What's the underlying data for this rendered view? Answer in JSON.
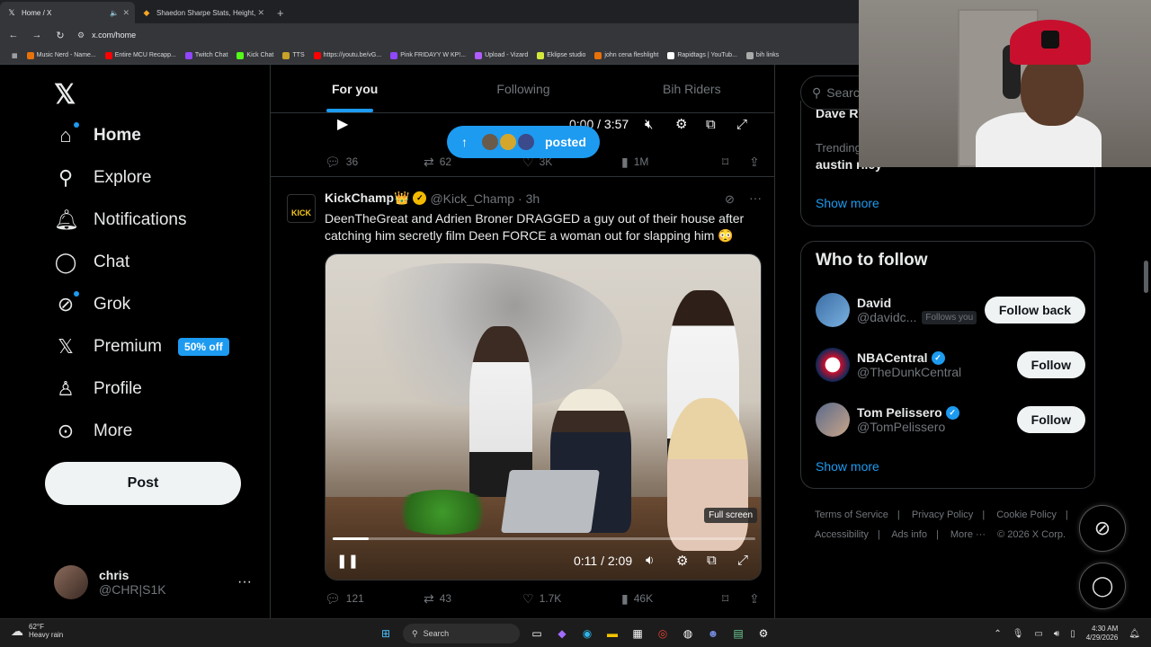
{
  "browser": {
    "tabs": [
      {
        "label": "Home / X",
        "active": true
      },
      {
        "label": "Shaedon Sharpe Stats, Height, ...",
        "active": false
      }
    ],
    "url": "x.com/home",
    "bookmarks": [
      {
        "label": "Music Nerd - Name...",
        "color": "#e8710a"
      },
      {
        "label": "Entire MCU Recapp...",
        "color": "#ff0000"
      },
      {
        "label": "Twitch Chat",
        "color": "#9146ff"
      },
      {
        "label": "Kick Chat",
        "color": "#53fc18"
      },
      {
        "label": "TTS",
        "color": "#c9a227"
      },
      {
        "label": "https://youtu.be/vG...",
        "color": "#ff0000"
      },
      {
        "label": "Pink FRIDAYY W KP!...",
        "color": "#9146ff"
      },
      {
        "label": "Upload - Vizard",
        "color": "#b15cff"
      },
      {
        "label": "Eklipse studio",
        "color": "#d4e83b"
      },
      {
        "label": "john cena fleshlight",
        "color": "#e8710a"
      },
      {
        "label": "Rapidtags | YouTub...",
        "color": "#ffffff"
      },
      {
        "label": "bih links",
        "color": "#aaaaaa"
      }
    ]
  },
  "nav": {
    "items": [
      {
        "label": "Home"
      },
      {
        "label": "Explore"
      },
      {
        "label": "Notifications"
      },
      {
        "label": "Chat"
      },
      {
        "label": "Grok"
      },
      {
        "label": "Premium",
        "badge": "50% off"
      },
      {
        "label": "Profile"
      },
      {
        "label": "More"
      }
    ],
    "post_label": "Post",
    "account": {
      "name": "chris",
      "handle": "@CHR|S1K"
    }
  },
  "feed": {
    "tabs": [
      "For you",
      "Following",
      "Bih Riders"
    ],
    "posted_pill": "posted",
    "prev": {
      "time": "0:00 / 3:57",
      "replies": "36",
      "reposts": "62",
      "likes": "3K",
      "views": "1M"
    },
    "tweet": {
      "name": "KickChamp👑",
      "handle": "@Kick_Champ",
      "time": "· 3h",
      "avatar_text": "KICK",
      "body": "DeenTheGreat and Adrien Broner DRAGGED a guy out of their house after catching him secretly film Deen FORCE a woman out for slapping him 😳",
      "video_time": "0:11 / 2:09",
      "video_progress": 0.085,
      "fullscreen_tip": "Full screen",
      "replies": "121",
      "reposts": "43",
      "likes": "1.7K",
      "views": "46K"
    }
  },
  "right": {
    "search_placeholder": "Searc",
    "trend_top": "Dave Ro",
    "trend_label": "Trending",
    "trend_title": "austin riley",
    "show_more": "Show more",
    "who_to_follow": "Who to follow",
    "suggestions": [
      {
        "name": "David",
        "handle": "@davidc...",
        "follows_you": "Follows you",
        "button": "Follow back",
        "verified": false,
        "color": "#3b6ea5"
      },
      {
        "name": "NBACentral",
        "handle": "@TheDunkCentral",
        "follows_you": "",
        "button": "Follow",
        "verified": true,
        "color": "#c8102e"
      },
      {
        "name": "Tom Pelissero",
        "handle": "@TomPelissero",
        "follows_you": "",
        "button": "Follow",
        "verified": true,
        "color": "#5a6a8a"
      }
    ],
    "footer": [
      "Terms of Service",
      "|",
      "Privacy Policy",
      "|",
      "Cookie Policy",
      "|",
      "Accessibility",
      "|",
      "Ads info",
      "|",
      "More ···",
      "© 2026 X Corp."
    ]
  },
  "taskbar": {
    "temp": "62°F",
    "weather": "Heavy rain",
    "search": "Search",
    "time": "4:30 AM",
    "date": "4/29/2026"
  }
}
